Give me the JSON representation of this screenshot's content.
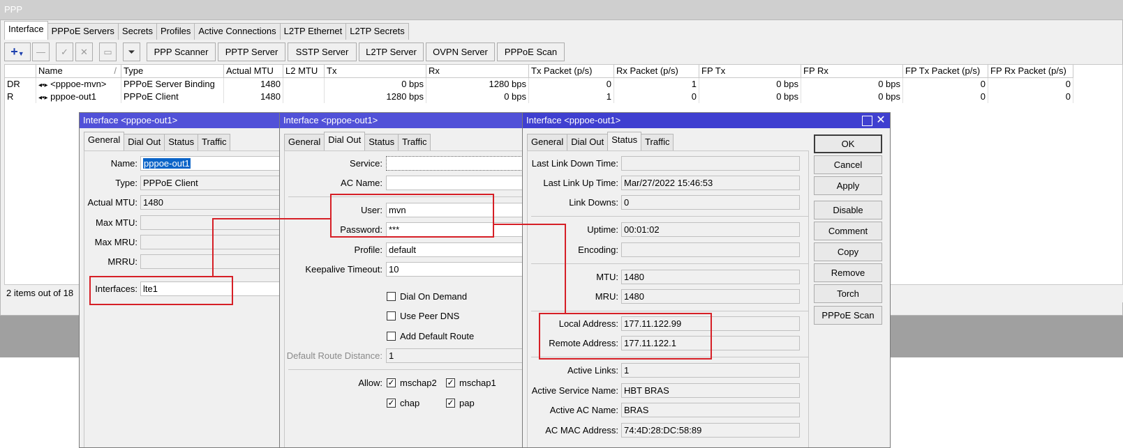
{
  "window": {
    "title": "PPP"
  },
  "tabs": [
    "Interface",
    "PPPoE Servers",
    "Secrets",
    "Profiles",
    "Active Connections",
    "L2TP Ethernet",
    "L2TP Secrets"
  ],
  "toolbar": {
    "add_icon": "plus-icon",
    "buttons": [
      "PPP Scanner",
      "PPTP Server",
      "SSTP Server",
      "L2TP Server",
      "OVPN Server",
      "PPPoE Scan"
    ]
  },
  "grid": {
    "columns": [
      "",
      "Name",
      "Type",
      "Actual MTU",
      "L2 MTU",
      "Tx",
      "Rx",
      "Tx Packet (p/s)",
      "Rx Packet (p/s)",
      "FP Tx",
      "FP Rx",
      "FP Tx Packet (p/s)",
      "FP Rx Packet (p/s)"
    ],
    "sort_indicator": "/",
    "rows": [
      [
        "DR",
        "<pppoe-mvn>",
        "PPPoE Server Binding",
        "1480",
        "",
        "0 bps",
        "1280 bps",
        "0",
        "1",
        "0 bps",
        "0 bps",
        "0",
        "0"
      ],
      [
        "R",
        "pppoe-out1",
        "PPPoE Client",
        "1480",
        "",
        "1280 bps",
        "0 bps",
        "1",
        "0",
        "0 bps",
        "0 bps",
        "0",
        "0"
      ]
    ],
    "row_icon": "interface-icon"
  },
  "status_bar": "2 items out of 18",
  "dialog_general": {
    "title": "Interface <pppoe-out1>",
    "tabs": [
      "General",
      "Dial Out",
      "Status",
      "Traffic"
    ],
    "fields": {
      "name_label": "Name:",
      "name": "pppoe-out1",
      "type_label": "Type:",
      "type": "PPPoE Client",
      "actual_mtu_label": "Actual MTU:",
      "actual_mtu": "1480",
      "max_mtu_label": "Max MTU:",
      "max_mru_label": "Max MRU:",
      "mrru_label": "MRRU:",
      "interfaces_label": "Interfaces:",
      "interfaces": "lte1"
    }
  },
  "dialog_dialout": {
    "title": "Interface <pppoe-out1>",
    "tabs": [
      "General",
      "Dial Out",
      "Status",
      "Traffic"
    ],
    "fields": {
      "service_label": "Service:",
      "ac_name_label": "AC Name:",
      "user_label": "User:",
      "user": "mvn",
      "password_label": "Password:",
      "password": "***",
      "profile_label": "Profile:",
      "profile": "default",
      "keepalive_label": "Keepalive Timeout:",
      "keepalive": "10",
      "dial_on_demand": "Dial On Demand",
      "use_peer_dns": "Use Peer DNS",
      "add_default_route": "Add Default Route",
      "default_route_distance_label": "Default Route Distance:",
      "default_route_distance": "1",
      "allow_label": "Allow:",
      "mschap2": "mschap2",
      "mschap1": "mschap1",
      "chap": "chap",
      "pap": "pap"
    }
  },
  "dialog_status": {
    "title": "Interface <pppoe-out1>",
    "tabs": [
      "General",
      "Dial Out",
      "Status",
      "Traffic"
    ],
    "fields": {
      "last_link_down_label": "Last Link Down Time:",
      "last_link_up_label": "Last Link Up Time:",
      "last_link_up": "Mar/27/2022 15:46:53",
      "link_downs_label": "Link Downs:",
      "link_downs": "0",
      "uptime_label": "Uptime:",
      "uptime": "00:01:02",
      "encoding_label": "Encoding:",
      "mtu_label": "MTU:",
      "mtu": "1480",
      "mru_label": "MRU:",
      "mru": "1480",
      "local_address_label": "Local Address:",
      "local_address": "177.11.122.99",
      "remote_address_label": "Remote Address:",
      "remote_address": "177.11.122.1",
      "active_links_label": "Active Links:",
      "active_links": "1",
      "active_service_name_label": "Active Service Name:",
      "active_service_name": "HBT BRAS",
      "active_ac_name_label": "Active AC Name:",
      "active_ac_name": "BRAS",
      "ac_mac_label": "AC MAC Address:",
      "ac_mac": "74:4D:28:DC:58:89"
    },
    "buttons": [
      "OK",
      "Cancel",
      "Apply",
      "Disable",
      "Comment",
      "Copy",
      "Remove",
      "Torch",
      "PPPoE Scan"
    ]
  },
  "colors": {
    "titlebar_active": "#3f3fd0",
    "highlight": "#d61f26",
    "selection": "#0a64c8"
  }
}
